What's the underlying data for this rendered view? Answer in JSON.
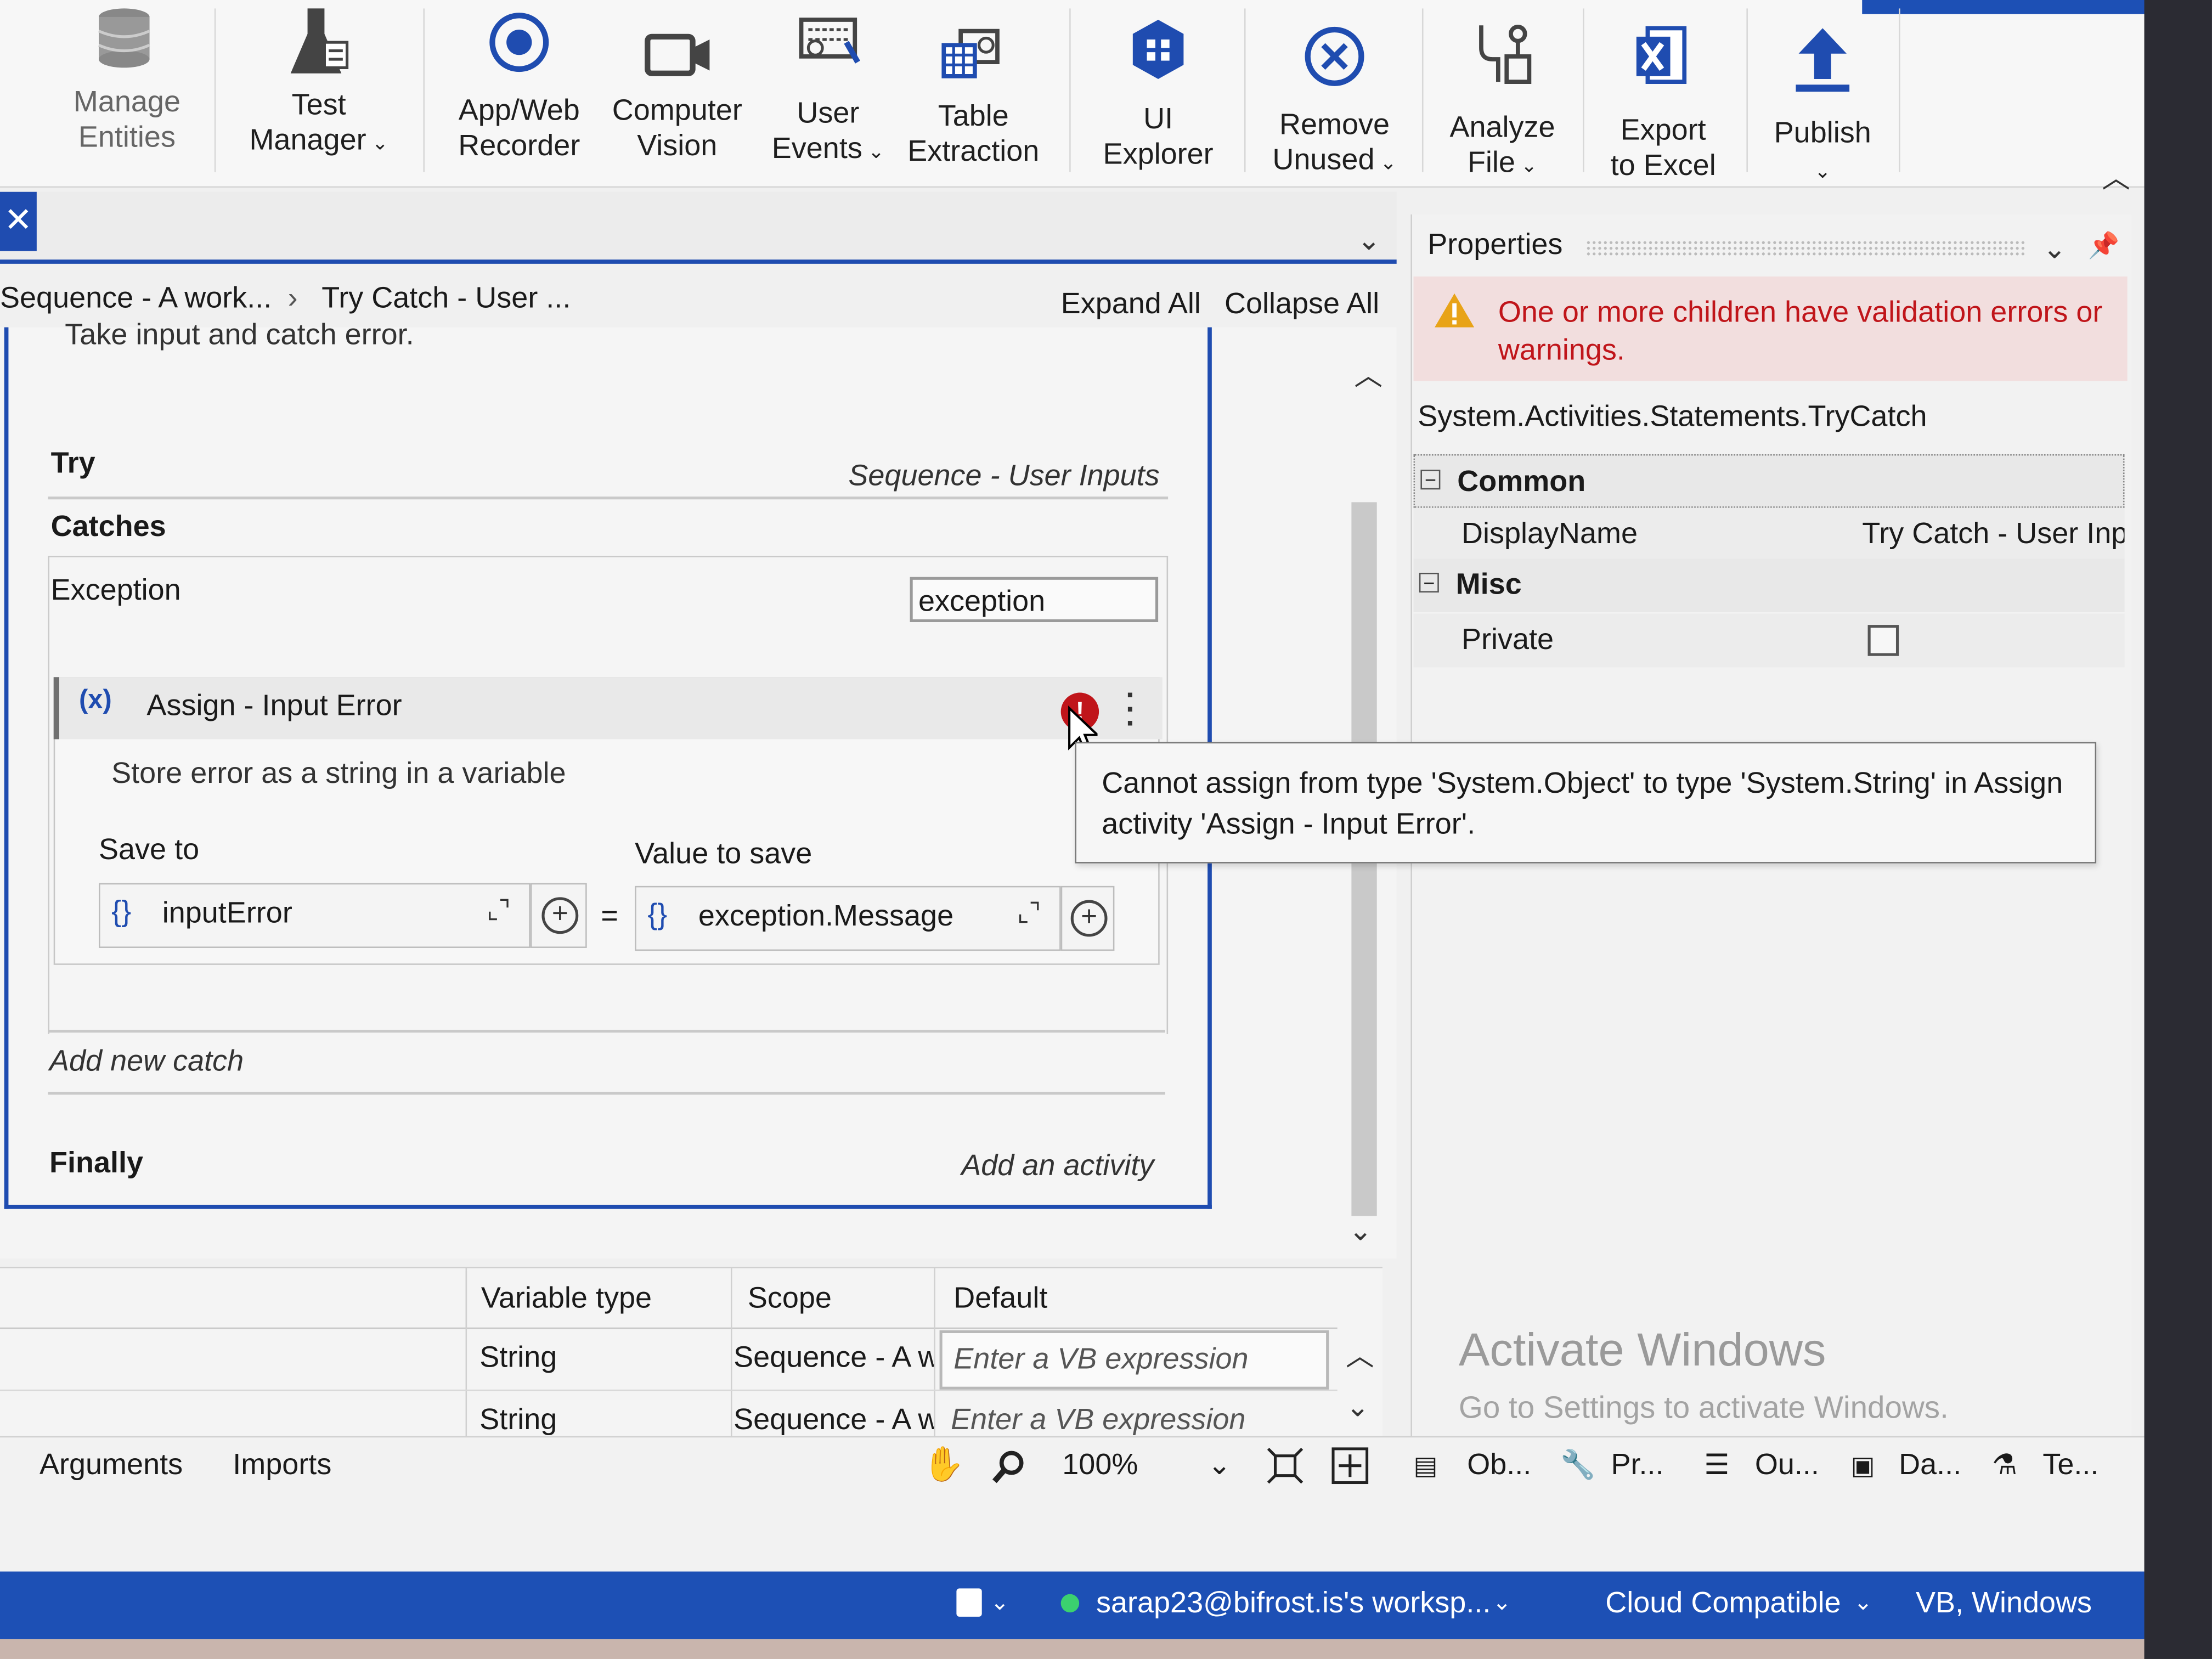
{
  "ribbon": {
    "items": [
      {
        "line1": "Manage",
        "line2": "Entities",
        "icon": "database-icon",
        "disabled": true
      },
      {
        "line1": "Test",
        "line2": "Manager",
        "chevron": true,
        "icon": "flask-icon"
      },
      {
        "line1": "App/Web",
        "line2": "Recorder",
        "icon": "record-icon"
      },
      {
        "line1": "Computer",
        "line2": "Vision",
        "icon": "video-camera-icon"
      },
      {
        "line1": "User",
        "line2": "Events",
        "chevron": true,
        "icon": "keyboard-icon"
      },
      {
        "line1": "Table",
        "line2": "Extraction",
        "icon": "table-extraction-icon"
      },
      {
        "line1": "UI",
        "line2": "Explorer",
        "icon": "ui-explorer-icon"
      },
      {
        "line1": "Remove",
        "line2": "Unused",
        "chevron": true,
        "icon": "remove-circle-icon"
      },
      {
        "line1": "Analyze",
        "line2": "File",
        "chevron": true,
        "icon": "analyze-icon"
      },
      {
        "line1": "Export",
        "line2": "to Excel",
        "icon": "excel-icon"
      },
      {
        "line1": "Publish",
        "line2": "",
        "chevron": true,
        "icon": "upload-arrow-icon"
      }
    ]
  },
  "breadcrumb": {
    "part1": "Sequence - A work...",
    "part2": "Try Catch - User ..."
  },
  "designer": {
    "expand_all": "Expand All",
    "collapse_all": "Collapse All",
    "annotation": "Take input and catch error.",
    "try_label": "Try",
    "try_value": "Sequence - User Inputs",
    "catches_label": "Catches",
    "exception_label": "Exception",
    "exception_var": "exception",
    "assign": {
      "title": "Assign - Input Error",
      "description": "Store error as a string in a variable",
      "save_to_label": "Save to",
      "value_to_save_label": "Value to save",
      "save_to_value": "inputError",
      "value_value": "exception.Message",
      "equals": "="
    },
    "add_new_catch": "Add new catch",
    "finally_label": "Finally",
    "add_activity": "Add an activity",
    "tooltip": "Cannot assign from type 'System.Object' to type 'System.String' in Assign activity 'Assign - Input Error'."
  },
  "properties": {
    "title": "Properties",
    "warning": "One or more children have validation errors or warnings.",
    "type_name": "System.Activities.Statements.TryCatch",
    "common_label": "Common",
    "display_name_label": "DisplayName",
    "display_name_value": "Try Catch - User Inp",
    "misc_label": "Misc",
    "private_label": "Private",
    "private_checked": false
  },
  "variables": {
    "headers": [
      "Variable type",
      "Scope",
      "Default"
    ],
    "rows": [
      {
        "type": "String",
        "scope": "Sequence - A w",
        "default": "Enter a VB expression"
      },
      {
        "type": "String",
        "scope": "Sequence - A w",
        "default": "Enter a VB expression"
      }
    ]
  },
  "bottom_bar": {
    "arguments": "Arguments",
    "imports": "Imports",
    "zoom": "100%",
    "panels": [
      "Ob...",
      "Pr...",
      "Ou...",
      "Da...",
      "Te..."
    ]
  },
  "watermark": {
    "line1": "Activate Windows",
    "line2": "Go to Settings to activate Windows."
  },
  "status_bar": {
    "workspace": "sarap23@bifrost.is's worksp...",
    "compat": "Cloud Compatible",
    "lang": "VB, Windows"
  },
  "colors": {
    "accent": "#1f4cb0",
    "error": "#c0151a",
    "warning": "#e8a317",
    "status_bar": "#1d50b5"
  }
}
